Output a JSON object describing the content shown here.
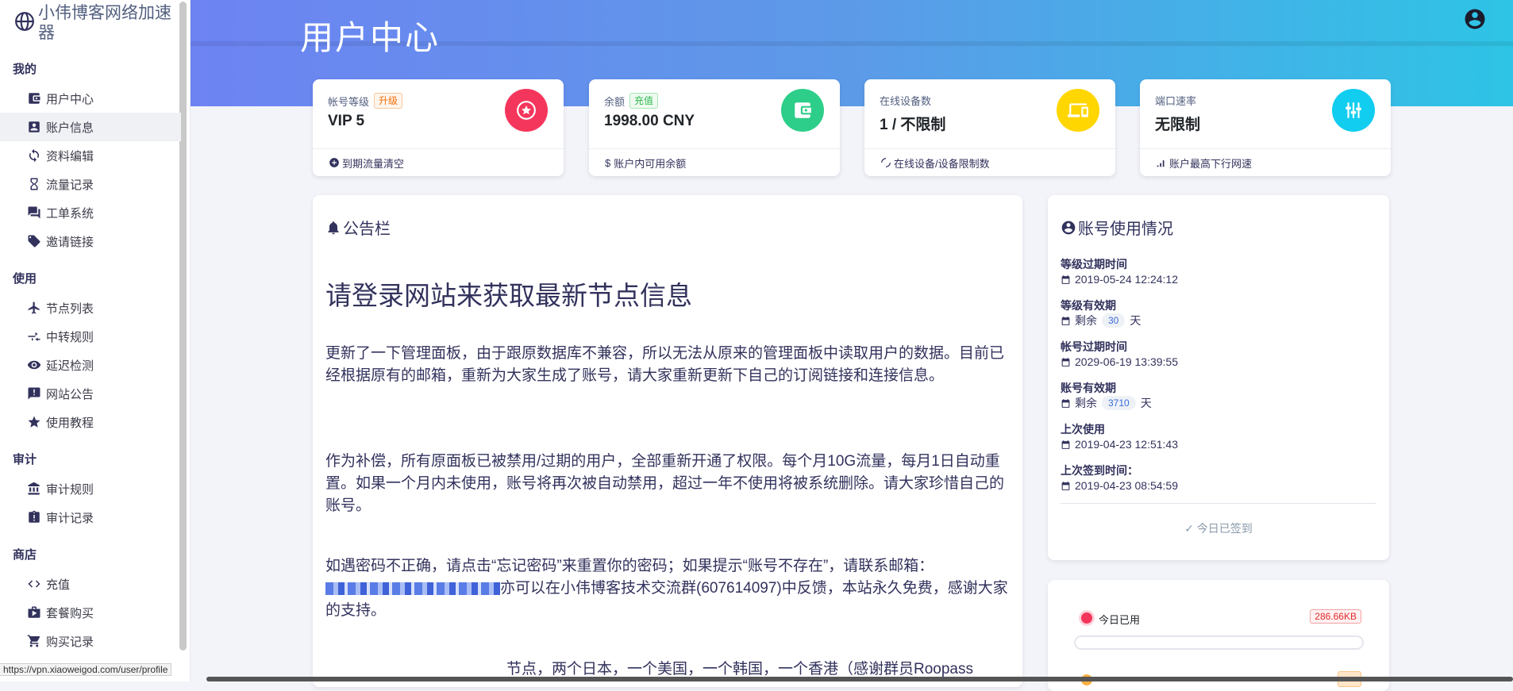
{
  "brand": {
    "title": "小伟博客网络加速器"
  },
  "header": {
    "title": "用户中心"
  },
  "sidebar": {
    "groups": [
      {
        "heading": "我的",
        "items": [
          {
            "label": "用户中心",
            "icon": "wallet-icon"
          },
          {
            "label": "账户信息",
            "icon": "account-box-icon",
            "active": true
          },
          {
            "label": "资料编辑",
            "icon": "sync-icon"
          },
          {
            "label": "流量记录",
            "icon": "hourglass-icon"
          },
          {
            "label": "工单系统",
            "icon": "chat-icon"
          },
          {
            "label": "邀请链接",
            "icon": "tag-icon"
          }
        ]
      },
      {
        "heading": "使用",
        "items": [
          {
            "label": "节点列表",
            "icon": "airplane-icon"
          },
          {
            "label": "中转规则",
            "icon": "transfer-icon"
          },
          {
            "label": "延迟检测",
            "icon": "eye-icon"
          },
          {
            "label": "网站公告",
            "icon": "announcement-icon"
          },
          {
            "label": "使用教程",
            "icon": "star-icon"
          }
        ]
      },
      {
        "heading": "审计",
        "items": [
          {
            "label": "审计规则",
            "icon": "bank-icon"
          },
          {
            "label": "审计记录",
            "icon": "clipboard-alert-icon"
          }
        ]
      },
      {
        "heading": "商店",
        "items": [
          {
            "label": "充值",
            "icon": "code-icon"
          },
          {
            "label": "套餐购买",
            "icon": "shopping-bag-icon"
          },
          {
            "label": "购买记录",
            "icon": "cart-icon"
          }
        ]
      }
    ]
  },
  "stats": [
    {
      "label": "帐号等级",
      "badge": "升级",
      "value": "VIP 5",
      "footer": "到期流量清空",
      "color": "#f5365c"
    },
    {
      "label": "余额",
      "badge": "充值",
      "value": "1998.00 CNY",
      "footer": "账户内可用余额",
      "color": "#2dce89"
    },
    {
      "label": "在线设备数",
      "value": "1 / 不限制",
      "footer": "在线设备/设备限制数",
      "color": "#ffd600"
    },
    {
      "label": "端口速率",
      "value": "无限制",
      "footer": "账户最高下行网速",
      "color": "#11cdef"
    }
  ],
  "announcement": {
    "title": "公告栏",
    "heading": "请登录网站来获取最新节点信息",
    "p1": "更新了一下管理面板，由于跟原数据库不兼容，所以无法从原来的管理面板中读取用户的数据。目前已经根据原有的邮箱，重新为大家生成了账号，请大家重新更新下自己的订阅链接和连接信息。",
    "p2": "作为补偿，所有原面板已被禁用/过期的用户，全部重新开通了权限。每个月10G流量，每月1日自动重置。如果一个月内未使用，账号将再次被自动禁用，超过一年不使用将被系统删除。请大家珍惜自己的账号。",
    "p3a": "如遇密码不正确，请点击“忘记密码”来重置你的密码；如果提示“账号不存在”，请联系邮箱：",
    "p3b": "亦可以在小伟博客技术交流群(607614097)中反馈，本站永久免费，感谢大家的支持。",
    "p4": "节点，两个日本，一个美国，一个韩国，一个香港（感谢群员Roopass"
  },
  "usage": {
    "title": "账号使用情况",
    "rows": [
      {
        "label": "等级过期时间",
        "value": "2019-05-24 12:24:12"
      },
      {
        "label": "等级有效期",
        "prefix": "剩余",
        "days": "30",
        "suffix": "天"
      },
      {
        "label": "帐号过期时间",
        "value": "2029-06-19 13:39:55"
      },
      {
        "label": "账号有效期",
        "prefix": "剩余",
        "days": "3710",
        "suffix": "天"
      },
      {
        "label": "上次使用",
        "value": "2019-04-23 12:51:43"
      },
      {
        "label": "上次签到时间：",
        "value": "2019-04-23 08:54:59"
      }
    ],
    "signed_in": "✓ 今日已签到"
  },
  "traffic": {
    "today_label": "今日已用",
    "today_value": "286.66KB",
    "today_fraction": 0.0
  },
  "statusbar": {
    "url": "https://vpn.xiaoweigod.com/user/profile"
  }
}
